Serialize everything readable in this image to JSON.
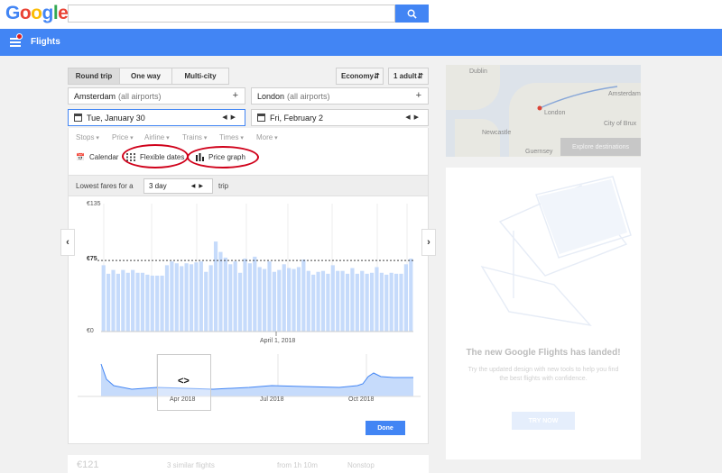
{
  "logo": [
    "G",
    "o",
    "o",
    "g",
    "l",
    "e"
  ],
  "logo_colors": [
    "#4285f4",
    "#ea4335",
    "#fbbc05",
    "#4285f4",
    "#34a853",
    "#ea4335"
  ],
  "search": {
    "value": "",
    "placeholder": ""
  },
  "appbar": {
    "title": "Flights"
  },
  "trip_types": [
    "Round trip",
    "One way",
    "Multi-city"
  ],
  "cabin": "Economy",
  "passengers": "1 adult",
  "origin": {
    "city": "Amsterdam",
    "qualifier": "(all airports)"
  },
  "destination": {
    "city": "London",
    "qualifier": "(all airports)"
  },
  "depart_date": "Tue, January 30",
  "return_date": "Fri, February 2",
  "filters": [
    "Stops",
    "Price",
    "Airline",
    "Trains",
    "Times",
    "More"
  ],
  "views": {
    "calendar": "Calendar",
    "flexible": "Flexible dates",
    "price_graph": "Price graph"
  },
  "lowest": {
    "prefix": "Lowest fares for a",
    "duration": "3 day",
    "suffix": "trip"
  },
  "chart_data": {
    "type": "bar",
    "ylim": [
      0,
      135
    ],
    "y_tick_labels": [
      "€135",
      "€75",
      "€0"
    ],
    "reference_line": 75,
    "x_marker_label": "April 1, 2018",
    "values": [
      70,
      61,
      65,
      61,
      65,
      62,
      65,
      62,
      62,
      60,
      59,
      59,
      59,
      70,
      74,
      72,
      69,
      72,
      71,
      73,
      74,
      63,
      70,
      95,
      84,
      78,
      71,
      74,
      62,
      77,
      72,
      79,
      68,
      66,
      74,
      63,
      65,
      71,
      67,
      66,
      68,
      76,
      64,
      60,
      63,
      64,
      61,
      70,
      64,
      64,
      61,
      67,
      61,
      64,
      61,
      62,
      68,
      62,
      60,
      62,
      61,
      61,
      71,
      77
    ],
    "overview": {
      "labels": [
        "Apr 2018",
        "Jul 2018",
        "Oct 2018"
      ]
    }
  },
  "done_label": "Done",
  "map_labels": [
    "Dublin",
    "Amsterdam",
    "London",
    "City of Brux",
    "Guernsey",
    "Newcastle"
  ],
  "explore_label": "Explore destinations",
  "promo": {
    "title": "The new Google Flights has landed!",
    "desc": "Try the updated design with new tools to help you find the best flights with confidence.",
    "cta": "TRY NOW"
  },
  "result_row": {
    "price": "€121",
    "similar": "3 similar flights",
    "duration": "from 1h 10m",
    "stops": "Nonstop"
  },
  "colors": {
    "accent": "#4285f4",
    "bar": "#c6dbfb",
    "annotation": "#d0021b"
  }
}
